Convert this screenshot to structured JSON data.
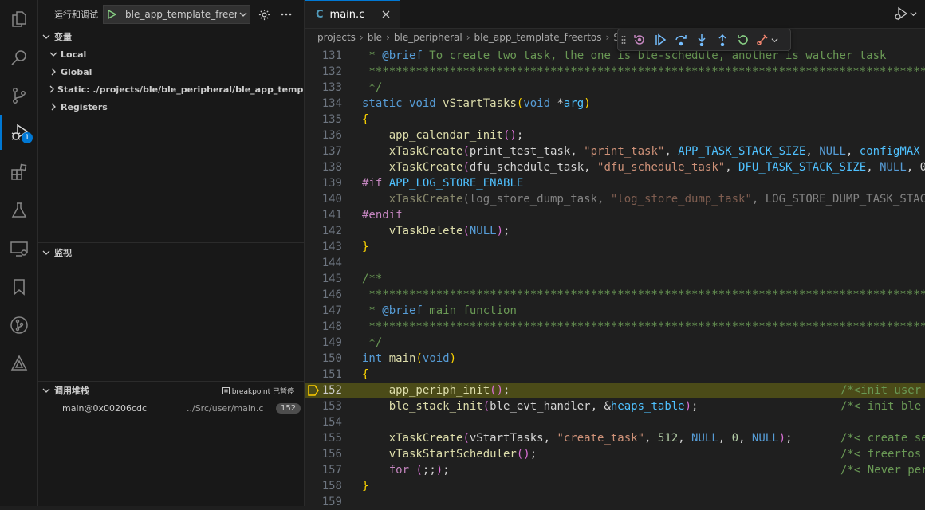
{
  "activity": [
    {
      "name": "explorer-icon"
    },
    {
      "name": "search-icon"
    },
    {
      "name": "source-control-icon"
    },
    {
      "name": "run-debug-icon",
      "badge": "1"
    },
    {
      "name": "extensions-icon"
    },
    {
      "name": "testing-icon"
    },
    {
      "name": "remote-explorer-icon"
    },
    {
      "name": "bookmarks-icon"
    },
    {
      "name": "git-graph-icon"
    },
    {
      "name": "extension-tool-icon"
    }
  ],
  "sidebar": {
    "title": "运行和调试",
    "config_name": "ble_app_template_freer",
    "variables": {
      "header": "变量",
      "items": [
        "Local",
        "Global",
        "Static: ./projects/ble/ble_peripheral/ble_app_template_free",
        "Registers"
      ]
    },
    "watch": {
      "header": "监视"
    },
    "call_stack": {
      "header": "调用堆栈",
      "status": "breakpoint 已暂停",
      "frames": [
        {
          "fn": "main@0x00206cdc",
          "file": "../Src/user/main.c",
          "line": "152"
        }
      ]
    }
  },
  "editor": {
    "tab": {
      "icon": "C",
      "name": "main.c"
    },
    "breadcrumbs": [
      "projects",
      "ble",
      "ble_peripheral",
      "ble_app_template_freertos",
      "Sr"
    ],
    "current_line": "152",
    "lines": [
      {
        "n": "131",
        "html": "<span class=\"cm\"> * </span><span class=\"kw\">@brief</span><span class=\"cm\"> To create two task, the one is ble-schedule, another is watcher task</span>"
      },
      {
        "n": "132",
        "html": "<span class=\"cm\"> *****************************************************************************************</span>"
      },
      {
        "n": "133",
        "html": "<span class=\"cm\"> */</span>"
      },
      {
        "n": "134",
        "html": "<span class=\"kw\">static</span> <span class=\"ty\">void</span> <span class=\"fn\">vStartTasks</span><span class=\"pa\">(</span><span class=\"ty\">void</span> *<span class=\"mc\">arg</span><span class=\"pa\">)</span>"
      },
      {
        "n": "135",
        "html": "<span class=\"pa\">{</span>"
      },
      {
        "n": "136",
        "html": "    <span class=\"fn\">app_calendar_init</span><span class=\"pa2\">()</span>;"
      },
      {
        "n": "137",
        "html": "    <span class=\"fn\">xTaskCreate</span><span class=\"pa2\">(</span>print_test_task, <span class=\"st\">\"print_task\"</span>, <span class=\"mc\">APP_TASK_STACK_SIZE</span>, <span class=\"kw\">NULL</span>, <span class=\"mc\">configMAX</span>"
      },
      {
        "n": "138",
        "html": "    <span class=\"fn\">xTaskCreate</span><span class=\"pa2\">(</span>dfu_schedule_task, <span class=\"st\">\"dfu_schedule_task\"</span>, <span class=\"mc\">DFU_TASK_STACK_SIZE</span>, <span class=\"kw\">NULL</span>, 0"
      },
      {
        "n": "139",
        "html": "<span class=\"pr\">#if</span> <span class=\"mc\">APP_LOG_STORE_ENABLE</span>"
      },
      {
        "n": "140",
        "html": "<span class=\"dim\">    <span class=\"fn\">xTaskCreate</span>(log_store_dump_task, <span class=\"st\">\"log_store_dump_task\"</span>, LOG_STORE_DUMP_TASK_STACK</span>"
      },
      {
        "n": "141",
        "html": "<span class=\"pr\">#endif</span>"
      },
      {
        "n": "142",
        "html": "    <span class=\"fn\">vTaskDelete</span><span class=\"pa2\">(</span><span class=\"kw\">NULL</span><span class=\"pa2\">)</span>;"
      },
      {
        "n": "143",
        "html": "<span class=\"pa\">}</span>"
      },
      {
        "n": "144",
        "html": ""
      },
      {
        "n": "145",
        "html": "<span class=\"cm\">/**</span>"
      },
      {
        "n": "146",
        "html": "<span class=\"cm\"> *****************************************************************************************</span>"
      },
      {
        "n": "147",
        "html": "<span class=\"cm\"> * </span><span class=\"kw\">@brief</span><span class=\"cm\"> main function</span>"
      },
      {
        "n": "148",
        "html": "<span class=\"cm\"> *****************************************************************************************</span>"
      },
      {
        "n": "149",
        "html": "<span class=\"cm\"> */</span>"
      },
      {
        "n": "150",
        "html": "<span class=\"ty\">int</span> <span class=\"fn\">main</span><span class=\"pa\">(</span><span class=\"ty\">void</span><span class=\"pa\">)</span>"
      },
      {
        "n": "151",
        "html": "<span class=\"pa\">{</span>"
      },
      {
        "n": "152",
        "html": "    <span class=\"fn\">app_periph_init</span><span class=\"pa2\">()</span>;",
        "comment": "/*<init user"
      },
      {
        "n": "153",
        "html": "    <span class=\"fn\">ble_stack_init</span><span class=\"pa2\">(</span>ble_evt_handler, &amp;<span class=\"mc\">heaps_table</span><span class=\"pa2\">)</span>;",
        "comment": "/*< init ble"
      },
      {
        "n": "154",
        "html": ""
      },
      {
        "n": "155",
        "html": "    <span class=\"fn\">xTaskCreate</span><span class=\"pa2\">(</span>vStartTasks, <span class=\"st\">\"create_task\"</span>, <span class=\"nu\">512</span>, <span class=\"kw\">NULL</span>, <span class=\"nu\">0</span>, <span class=\"kw\">NULL</span><span class=\"pa2\">)</span>;",
        "comment": "/*< create se"
      },
      {
        "n": "156",
        "html": "    <span class=\"fn\">vTaskStartScheduler</span><span class=\"pa2\">()</span>;",
        "comment": "/*< freertos"
      },
      {
        "n": "157",
        "html": "    <span class=\"pr\">for</span> <span class=\"pa2\">(</span>;;<span class=\"pa2\">)</span>;",
        "comment": "/*< Never per"
      },
      {
        "n": "158",
        "html": "<span class=\"pa\">}</span>"
      },
      {
        "n": "159",
        "html": ""
      }
    ]
  },
  "colors": {
    "accent": "#0078d4",
    "current_line_bg": "#4b4b18",
    "breakpoint_arrow": "#ffcc00"
  }
}
